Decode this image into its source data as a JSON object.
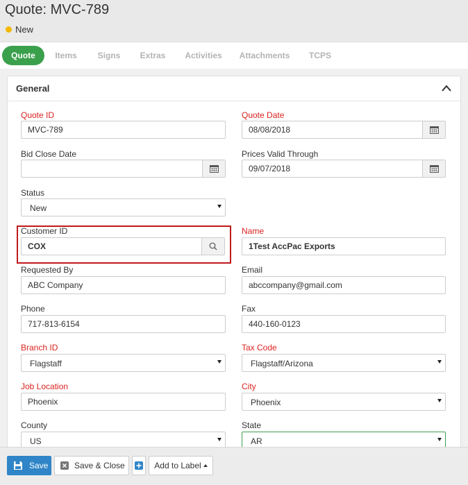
{
  "header": {
    "title": "Quote: MVC-789",
    "status": "New",
    "status_color": "#f5b800"
  },
  "tabs": [
    {
      "label": "Quote",
      "active": true
    },
    {
      "label": "Items"
    },
    {
      "label": "Signs"
    },
    {
      "label": "Extras"
    },
    {
      "label": "Activities"
    },
    {
      "label": "Attachments"
    },
    {
      "label": "TCPS"
    }
  ],
  "panel": {
    "title": "General"
  },
  "form": {
    "quote_id": {
      "label": "Quote ID",
      "value": "MVC-789"
    },
    "quote_date": {
      "label": "Quote Date",
      "value": "08/08/2018"
    },
    "bid_close_date": {
      "label": "Bid Close Date",
      "value": ""
    },
    "prices_valid_through": {
      "label": "Prices Valid Through",
      "value": "09/07/2018"
    },
    "status": {
      "label": "Status",
      "value": "New"
    },
    "customer_id": {
      "label": "Customer ID",
      "value": "COX"
    },
    "name": {
      "label": "Name",
      "value": "1Test AccPac Exports"
    },
    "requested_by": {
      "label": "Requested By",
      "value": "ABC Company"
    },
    "email": {
      "label": "Email",
      "value": "abccompany@gmail.com"
    },
    "phone": {
      "label": "Phone",
      "value": "717-813-6154"
    },
    "fax": {
      "label": "Fax",
      "value": "440-160-0123"
    },
    "branch_id": {
      "label": "Branch ID",
      "value": "Flagstaff"
    },
    "tax_code": {
      "label": "Tax Code",
      "value": "Flagstaff/Arizona"
    },
    "job_location": {
      "label": "Job Location",
      "value": "Phoenix"
    },
    "city": {
      "label": "City",
      "value": "Phoenix"
    },
    "county": {
      "label": "County",
      "value": "US"
    },
    "state": {
      "label": "State",
      "value": "AR"
    }
  },
  "footer": {
    "save_label": "Save",
    "save_close_label": "Save & Close",
    "add_to_label": "Add to Label"
  },
  "colors": {
    "accent_green": "#3ba04c",
    "primary_blue": "#2f85c7",
    "required_red": "#d9231f",
    "highlight_red": "#c0191c"
  }
}
